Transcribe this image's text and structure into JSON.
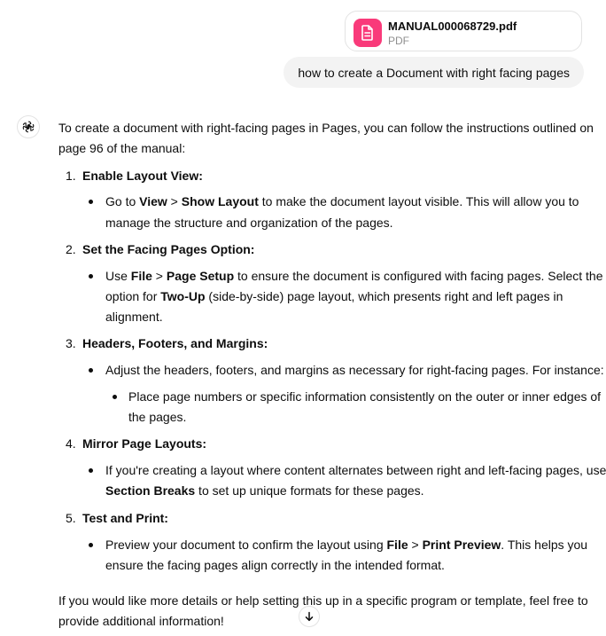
{
  "attachment": {
    "file_name": "MANUAL000068729.pdf",
    "file_type": "PDF",
    "icon": "document-icon",
    "icon_color": "#f93a7a"
  },
  "user_message": "how to create a Document with right facing pages",
  "assistant": {
    "avatar_icon": "openai-logo-icon",
    "intro": [
      "To create a document with right-facing pages in Pages, you can follow the instructions outlined on",
      "page 96 of the manual:"
    ],
    "steps": [
      {
        "number": "1.",
        "title": "Enable Layout View:",
        "bullets": [
          {
            "line1_pre": "Go to ",
            "b1": "View",
            "mid": " > ",
            "b2": "Show Layout",
            "line1_post": " to make the document layout visible. This will allow you to",
            "line2": "manage the structure and organization of the pages."
          }
        ]
      },
      {
        "number": "2.",
        "title": "Set the Facing Pages Option:",
        "bullets": [
          {
            "line1_pre": "Use ",
            "b1": "File",
            "mid": " > ",
            "b2": "Page Setup",
            "line1_post": " to ensure the document is configured with facing pages. Select the",
            "line2_pre": "option for ",
            "line2_bold": "Two-Up",
            "line2_post": " (side-by-side) page layout, which presents right and left pages in",
            "line3": "alignment."
          }
        ]
      },
      {
        "number": "3.",
        "title": "Headers, Footers, and Margins:",
        "bullets": [
          {
            "line1": "Adjust the headers, footers, and margins as necessary for right-facing pages. For instance:",
            "sub": {
              "line1": "Place page numbers or specific information consistently on the outer or inner edges of",
              "line2": "the pages."
            }
          }
        ]
      },
      {
        "number": "4.",
        "title": "Mirror Page Layouts:",
        "bullets": [
          {
            "line1": "If you're creating a layout where content alternates between right and left-facing pages, use",
            "line2_bold": "Section Breaks",
            "line2_post": " to set up unique formats for these pages."
          }
        ]
      },
      {
        "number": "5.",
        "title": "Test and Print:",
        "bullets": [
          {
            "line1_pre": "Preview your document to confirm the layout using ",
            "b1": "File",
            "mid": " > ",
            "b2": "Print Preview",
            "line1_post": ". This helps you",
            "line2": "ensure the facing pages align correctly in the intended format."
          }
        ]
      }
    ],
    "outro": [
      "If you would like more details or help setting this up in a specific program or template, feel free to",
      "provide additional information!"
    ]
  },
  "scroll_button_icon": "arrow-down-icon"
}
